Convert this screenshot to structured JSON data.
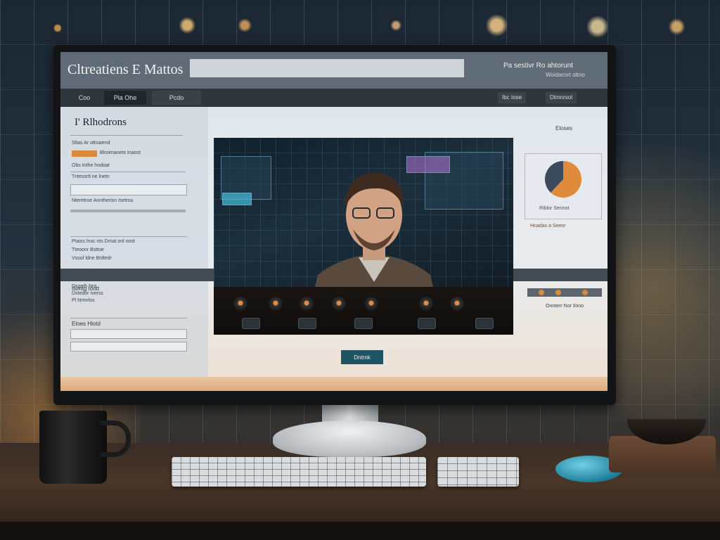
{
  "app": {
    "title": "Cltreatiens E Mattos",
    "search_value": "",
    "account_link": "Pa sestivr Ro ahtorunt",
    "account_sub": "Woidocnrt ottno"
  },
  "nav": {
    "tabs": [
      "Coo",
      "Pla Ohe",
      "Pcdo"
    ],
    "right_items": [
      "Ibc Iose",
      "Dtmnrsol"
    ]
  },
  "left_panel": {
    "heading": "I' Rlhodrons",
    "lines": [
      "Sltas Ar ottsaiend",
      "Blroimanets Inaost",
      "Obs Inthe hodoat",
      "Tntessrtl ne lnetn",
      "Nteretroe Anntherisn Isetrou",
      "Ptaiss lnsc nts Dmat onl oost",
      "Tteoonr Bsttoe",
      "Vssuf ldne Bnltedr",
      "Dsgeth Nnt",
      "Dstedor Iversc",
      "Pl Nrmrlos",
      "Ilsmtg Ioott",
      "Eloes Hlotd"
    ]
  },
  "right_panel": {
    "title": "Eloses",
    "chart_caption": "Riblor Sennot",
    "caption2": "Hnadas a Seeor",
    "caption3": "Onnterr Nor Ilono"
  },
  "cta_label": "Dntrnk",
  "chart_data": {
    "type": "pie",
    "values": [
      62,
      38
    ],
    "colors": [
      "#e08a3c",
      "#3a4a5c"
    ]
  }
}
